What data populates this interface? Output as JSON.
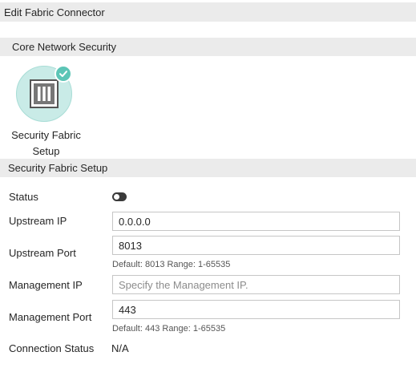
{
  "header": {
    "title": "Edit Fabric Connector"
  },
  "sections": {
    "core": {
      "title": "Core Network Security"
    },
    "setup": {
      "title": "Security Fabric Setup"
    }
  },
  "connector": {
    "label": "Security Fabric\nSetup",
    "icon": "server-rack-icon",
    "badge_icon": "check-icon",
    "selected": true,
    "colors": {
      "circle": "#c9ebe7",
      "badge": "#5cc5b6"
    }
  },
  "form": {
    "status": {
      "label": "Status",
      "enabled": false
    },
    "upstream_ip": {
      "label": "Upstream IP",
      "value": "0.0.0.0"
    },
    "upstream_port": {
      "label": "Upstream Port",
      "value": "8013",
      "hint": "Default: 8013 Range: 1-65535"
    },
    "management_ip": {
      "label": "Management IP",
      "value": "",
      "placeholder": "Specify the Management IP."
    },
    "management_port": {
      "label": "Management Port",
      "value": "443",
      "hint": "Default: 443 Range: 1-65535"
    },
    "connection_status": {
      "label": "Connection Status",
      "value": "N/A"
    }
  }
}
